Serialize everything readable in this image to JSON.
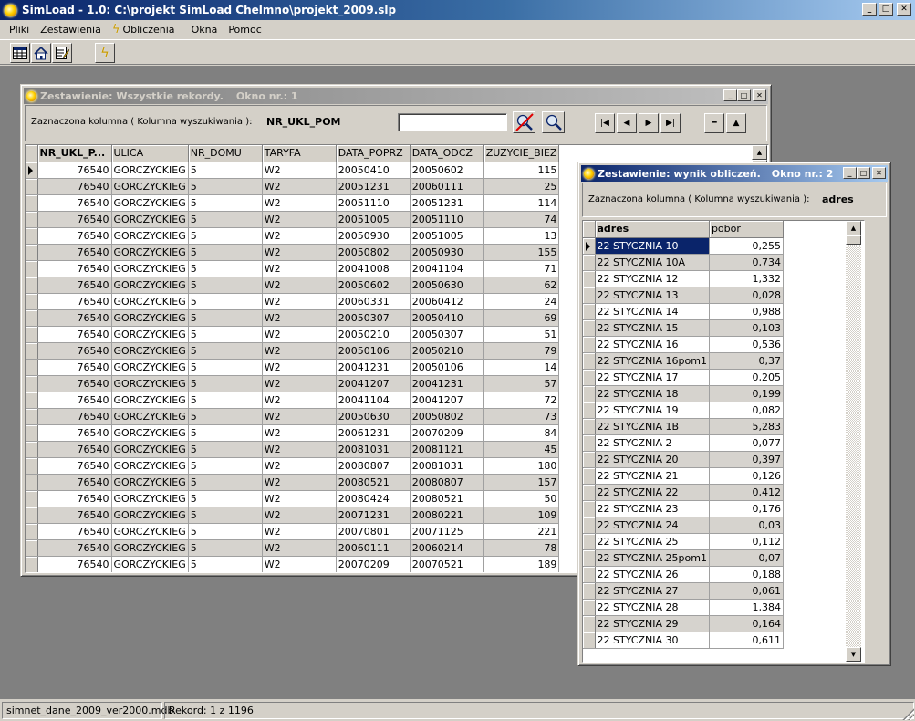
{
  "app": {
    "title": "SimLoad - 1.0:  C:\\projekt SimLoad Chelmno\\projekt_2009.slp",
    "min": "_",
    "max": "□",
    "close": "✕"
  },
  "menu": [
    {
      "label": "Pliki"
    },
    {
      "label": "Zestawienia"
    },
    {
      "label": "Obliczenia"
    },
    {
      "label": "Okna"
    },
    {
      "label": "Pomoc"
    }
  ],
  "toolbar": {
    "icons": [
      "table-icon",
      "home-icon",
      "edit-form-icon",
      "lightning-icon"
    ]
  },
  "window1": {
    "title": "Zestawienie: Wszystkie rekordy.",
    "window_no": "Okno nr.: 1",
    "filter_label": "Zaznaczona kolumna ( Kolumna wyszukiwania ):",
    "filter_value": "NR_UKL_POM",
    "search_value": "",
    "nav": {
      "first": "|◀",
      "prev": "◀",
      "next": "▶",
      "last": "▶|",
      "minus": "━",
      "up": "▲"
    },
    "columns": [
      "NR_UKL_P...",
      "ULICA",
      "NR_DOMU",
      "TARYFA",
      "DATA_POPRZ",
      "DATA_ODCZ",
      "ZUZYCIE_BIEZ"
    ],
    "rows": [
      [
        "76540",
        "GORCZYCKIEG",
        "5",
        "W2",
        "20050410",
        "20050602",
        "115"
      ],
      [
        "76540",
        "GORCZYCKIEG",
        "5",
        "W2",
        "20051231",
        "20060111",
        "25"
      ],
      [
        "76540",
        "GORCZYCKIEG",
        "5",
        "W2",
        "20051110",
        "20051231",
        "114"
      ],
      [
        "76540",
        "GORCZYCKIEG",
        "5",
        "W2",
        "20051005",
        "20051110",
        "74"
      ],
      [
        "76540",
        "GORCZYCKIEG",
        "5",
        "W2",
        "20050930",
        "20051005",
        "13"
      ],
      [
        "76540",
        "GORCZYCKIEG",
        "5",
        "W2",
        "20050802",
        "20050930",
        "155"
      ],
      [
        "76540",
        "GORCZYCKIEG",
        "5",
        "W2",
        "20041008",
        "20041104",
        "71"
      ],
      [
        "76540",
        "GORCZYCKIEG",
        "5",
        "W2",
        "20050602",
        "20050630",
        "62"
      ],
      [
        "76540",
        "GORCZYCKIEG",
        "5",
        "W2",
        "20060331",
        "20060412",
        "24"
      ],
      [
        "76540",
        "GORCZYCKIEG",
        "5",
        "W2",
        "20050307",
        "20050410",
        "69"
      ],
      [
        "76540",
        "GORCZYCKIEG",
        "5",
        "W2",
        "20050210",
        "20050307",
        "51"
      ],
      [
        "76540",
        "GORCZYCKIEG",
        "5",
        "W2",
        "20050106",
        "20050210",
        "79"
      ],
      [
        "76540",
        "GORCZYCKIEG",
        "5",
        "W2",
        "20041231",
        "20050106",
        "14"
      ],
      [
        "76540",
        "GORCZYCKIEG",
        "5",
        "W2",
        "20041207",
        "20041231",
        "57"
      ],
      [
        "76540",
        "GORCZYCKIEG",
        "5",
        "W2",
        "20041104",
        "20041207",
        "72"
      ],
      [
        "76540",
        "GORCZYCKIEG",
        "5",
        "W2",
        "20050630",
        "20050802",
        "73"
      ],
      [
        "76540",
        "GORCZYCKIEG",
        "5",
        "W2",
        "20061231",
        "20070209",
        "84"
      ],
      [
        "76540",
        "GORCZYCKIEG",
        "5",
        "W2",
        "20081031",
        "20081121",
        "45"
      ],
      [
        "76540",
        "GORCZYCKIEG",
        "5",
        "W2",
        "20080807",
        "20081031",
        "180"
      ],
      [
        "76540",
        "GORCZYCKIEG",
        "5",
        "W2",
        "20080521",
        "20080807",
        "157"
      ],
      [
        "76540",
        "GORCZYCKIEG",
        "5",
        "W2",
        "20080424",
        "20080521",
        "50"
      ],
      [
        "76540",
        "GORCZYCKIEG",
        "5",
        "W2",
        "20071231",
        "20080221",
        "109"
      ],
      [
        "76540",
        "GORCZYCKIEG",
        "5",
        "W2",
        "20070801",
        "20071125",
        "221"
      ],
      [
        "76540",
        "GORCZYCKIEG",
        "5",
        "W2",
        "20060111",
        "20060214",
        "78"
      ],
      [
        "76540",
        "GORCZYCKIEG",
        "5",
        "W2",
        "20070209",
        "20070521",
        "189"
      ]
    ]
  },
  "window2": {
    "title": "Zestawienie: wynik obliczeń.",
    "window_no": "Okno nr.: 2",
    "filter_label": "Zaznaczona kolumna ( Kolumna wyszukiwania ):",
    "filter_value": "adres",
    "columns": [
      "adres",
      "pobor"
    ],
    "rows": [
      [
        "22 STYCZNIA 10",
        "0,255"
      ],
      [
        "22 STYCZNIA 10A",
        "0,734"
      ],
      [
        "22 STYCZNIA 12",
        "1,332"
      ],
      [
        "22 STYCZNIA 13",
        "0,028"
      ],
      [
        "22 STYCZNIA 14",
        "0,988"
      ],
      [
        "22 STYCZNIA 15",
        "0,103"
      ],
      [
        "22 STYCZNIA 16",
        "0,536"
      ],
      [
        "22 STYCZNIA 16pom1",
        "0,37"
      ],
      [
        "22 STYCZNIA 17",
        "0,205"
      ],
      [
        "22 STYCZNIA 18",
        "0,199"
      ],
      [
        "22 STYCZNIA 19",
        "0,082"
      ],
      [
        "22 STYCZNIA 1B",
        "5,283"
      ],
      [
        "22 STYCZNIA 2",
        "0,077"
      ],
      [
        "22 STYCZNIA 20",
        "0,397"
      ],
      [
        "22 STYCZNIA 21",
        "0,126"
      ],
      [
        "22 STYCZNIA 22",
        "0,412"
      ],
      [
        "22 STYCZNIA 23",
        "0,176"
      ],
      [
        "22 STYCZNIA 24",
        "0,03"
      ],
      [
        "22 STYCZNIA 25",
        "0,112"
      ],
      [
        "22 STYCZNIA 25pom1",
        "0,07"
      ],
      [
        "22 STYCZNIA 26",
        "0,188"
      ],
      [
        "22 STYCZNIA 27",
        "0,061"
      ],
      [
        "22 STYCZNIA 28",
        "1,384"
      ],
      [
        "22 STYCZNIA 29",
        "0,164"
      ],
      [
        "22 STYCZNIA 30",
        "0,611"
      ]
    ]
  },
  "status": {
    "db_file": "simnet_dane_2009_ver2000.mdb",
    "record": "Rekord: 1 z 1196"
  }
}
